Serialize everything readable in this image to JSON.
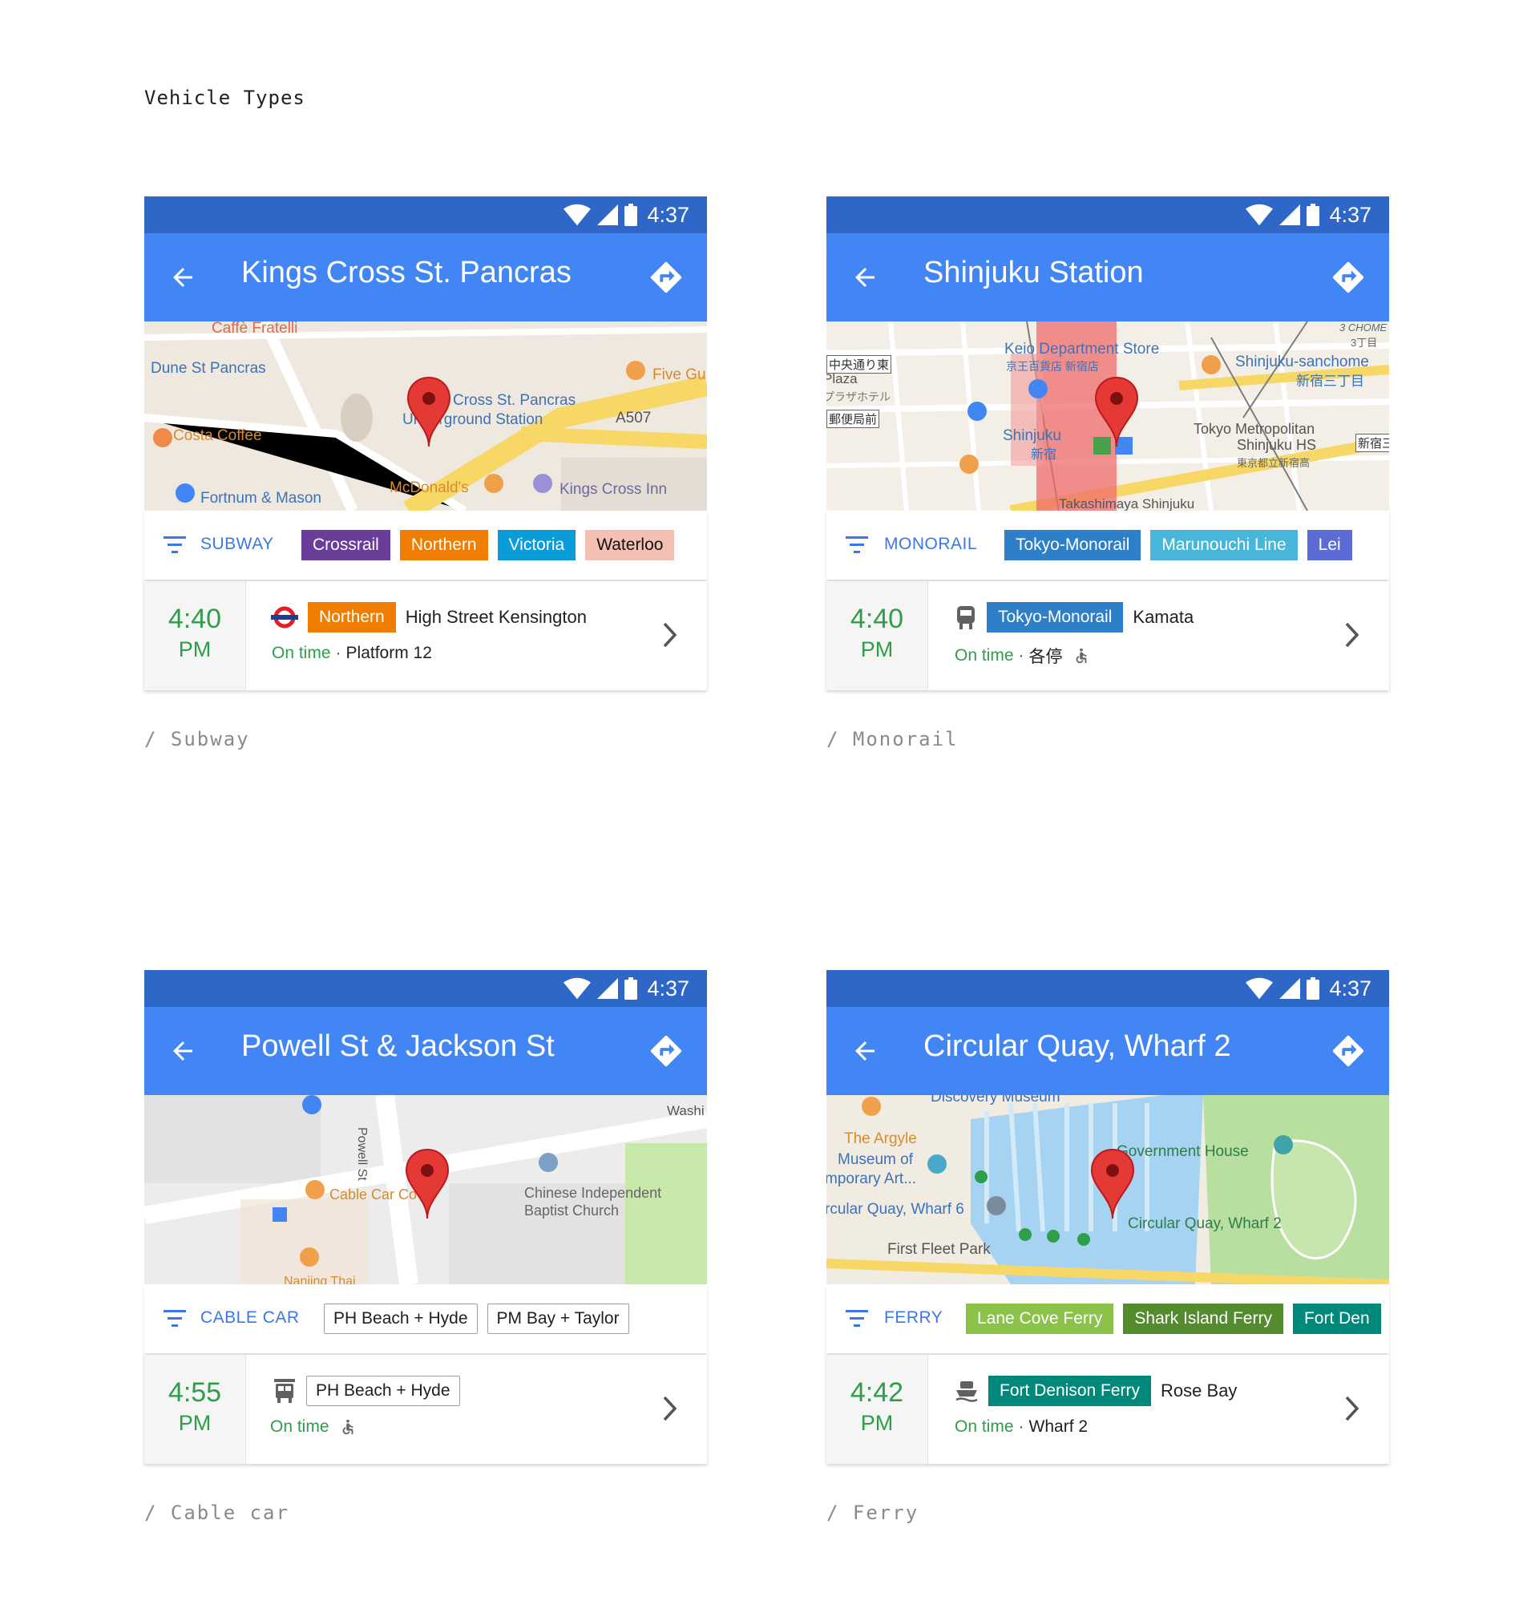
{
  "page": {
    "title": "Vehicle Types"
  },
  "status_time": "4:37",
  "cards": {
    "subway": {
      "caption": "/ Subway",
      "station": "Kings Cross St. Pancras",
      "mode": "SUBWAY",
      "lines": [
        {
          "label": "Crossrail",
          "color": "#6a3d99"
        },
        {
          "label": "Northern",
          "color": "#ef7d00"
        },
        {
          "label": "Victoria",
          "color": "#0a9cd9"
        },
        {
          "label": "Waterloo",
          "color": "#f2c1b3"
        }
      ],
      "map_labels": [
        "Caffè Fratelli",
        "Dune St Pancras",
        "Cross St. Pancras",
        "Underground Station",
        "Five Gu",
        "A507",
        "Costa Coffee",
        "McDonald's",
        "Kings Cross Inn",
        "Fortnum & Mason"
      ],
      "departure": {
        "time": "4:40",
        "ampm": "PM",
        "line": "Northern",
        "line_color": "#ef7d00",
        "destination": "High Street Kensington",
        "status": "On time",
        "detail": "Platform 12"
      }
    },
    "monorail": {
      "caption": "/ Monorail",
      "station": "Shinjuku Station",
      "mode": "MONORAIL",
      "lines": [
        {
          "label": "Tokyo-Monorail",
          "color": "#2f7fc8"
        },
        {
          "label": "Marunouchi Line",
          "color": "#47b6d9"
        },
        {
          "label": "Lei",
          "color": "#5c6bd6"
        }
      ],
      "map_labels": [
        "Keio Department Store",
        "京王百貨店 新宿店",
        "Shinjuku-sanchome",
        "新宿三丁目",
        "Plaza",
        "プラザホテル",
        "中央通り東",
        "郵便局前",
        "Shinjuku",
        "新宿",
        "Tokyo Metropolitan",
        "Shinjuku HS",
        "東京都立新宿高",
        "3 CHOME",
        "3丁目",
        "Takashimaya Shinjuku",
        "新宿三"
      ],
      "departure": {
        "time": "4:40",
        "ampm": "PM",
        "line": "Tokyo-Monorail",
        "line_color": "#2f7fc8",
        "destination": "Kamata",
        "status": "On time",
        "detail": "各停"
      }
    },
    "cablecar": {
      "caption": "/ Cable car",
      "station": "Powell St & Jackson St",
      "mode": "CABLE CAR",
      "lines": [
        {
          "label": "PH Beach + Hyde"
        },
        {
          "label": "PM Bay + Taylor"
        }
      ],
      "map_labels": [
        "Powell St",
        "Washi",
        "Cable Car Co",
        "Chinese Independent",
        "Baptist Church",
        "Nanjing Thai"
      ],
      "departure": {
        "time": "4:55",
        "ampm": "PM",
        "line": "PH Beach + Hyde",
        "status": "On time"
      }
    },
    "ferry": {
      "caption": "/ Ferry",
      "station": "Circular Quay, Wharf 2",
      "mode": "FERRY",
      "lines": [
        {
          "label": "Lane Cove Ferry",
          "color": "#8bc34a"
        },
        {
          "label": "Shark Island Ferry",
          "color": "#558b2f"
        },
        {
          "label": "Fort Den",
          "color": "#00897b"
        }
      ],
      "map_labels": [
        "Discovery Museum",
        "The Argyle",
        "Museum of",
        "mporary Art...",
        "rcular Quay, Wharf 6",
        "Government House",
        "Circular Quay, Wharf 2",
        "First Fleet Park"
      ],
      "departure": {
        "time": "4:42",
        "ampm": "PM",
        "line": "Fort Denison Ferry",
        "line_color": "#00897b",
        "destination": "Rose Bay",
        "status": "On time",
        "detail": "Wharf 2"
      }
    }
  }
}
